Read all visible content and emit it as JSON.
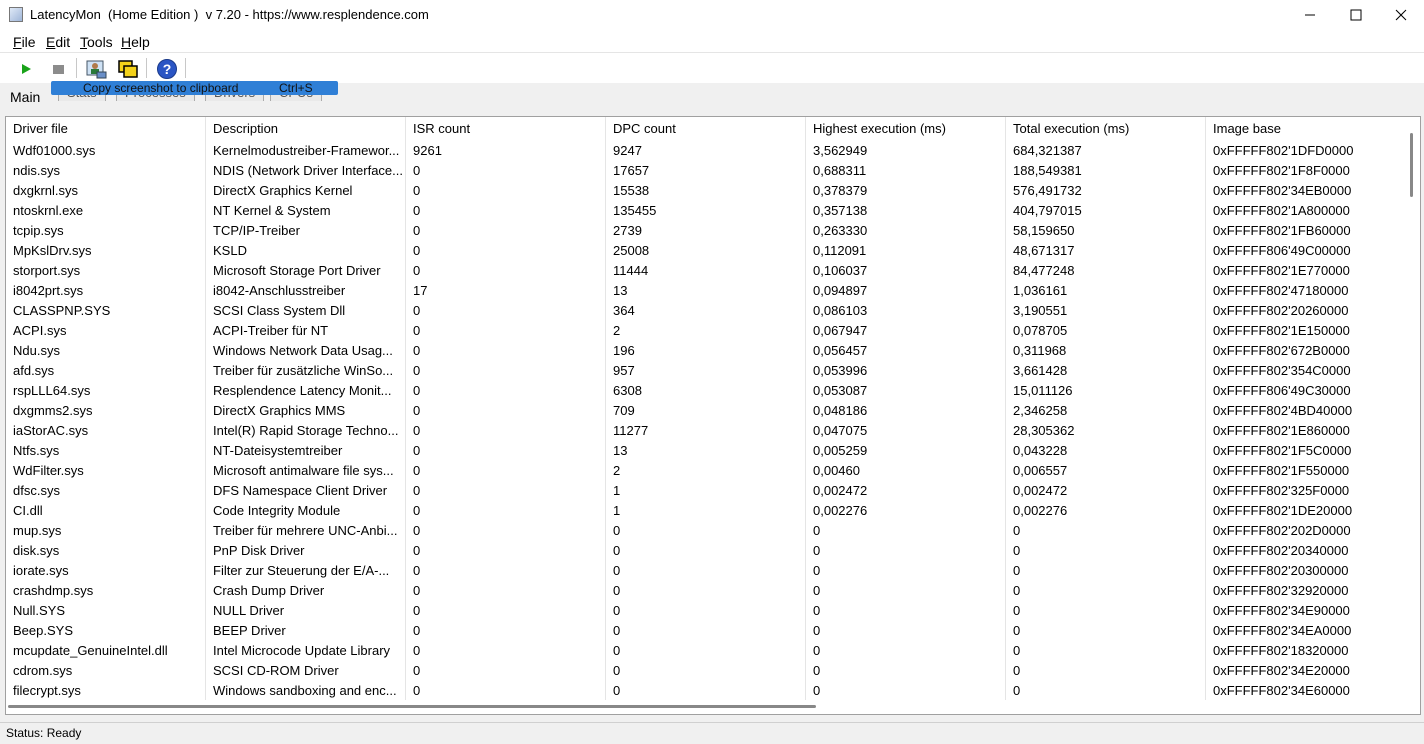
{
  "window": {
    "title": "LatencyMon  (Home Edition )  v 7.20 - https://www.resplendence.com"
  },
  "menu": [
    {
      "ul": "F",
      "rest": "ile"
    },
    {
      "ul": "E",
      "rest": "dit"
    },
    {
      "ul": "T",
      "rest": "ools"
    },
    {
      "ul": "H",
      "rest": "elp"
    }
  ],
  "toolbar": {
    "icons": [
      "play-icon",
      "stop-icon",
      "screenshot-user-icon",
      "copy-windows-icon",
      "help-icon"
    ]
  },
  "tabs": [
    "Main",
    "Stats",
    "Processes",
    "Drivers",
    "CPUs"
  ],
  "tooltip": {
    "label": "Copy screenshot to clipboard",
    "shortcut": "Ctrl+S"
  },
  "table": {
    "columns": [
      "Driver file",
      "Description",
      "ISR count",
      "DPC count",
      "Highest execution (ms)",
      "Total execution (ms)",
      "Image base"
    ],
    "rows": [
      [
        "Wdf01000.sys",
        "Kernelmodustreiber-Framewor...",
        "9261",
        "9247",
        "3,562949",
        "684,321387",
        "0xFFFFF802'1DFD0000"
      ],
      [
        "ndis.sys",
        "NDIS (Network Driver Interface...",
        "0",
        "17657",
        "0,688311",
        "188,549381",
        "0xFFFFF802'1F8F0000"
      ],
      [
        "dxgkrnl.sys",
        "DirectX Graphics Kernel",
        "0",
        "15538",
        "0,378379",
        "576,491732",
        "0xFFFFF802'34EB0000"
      ],
      [
        "ntoskrnl.exe",
        "NT Kernel & System",
        "0",
        "135455",
        "0,357138",
        "404,797015",
        "0xFFFFF802'1A800000"
      ],
      [
        "tcpip.sys",
        "TCP/IP-Treiber",
        "0",
        "2739",
        "0,263330",
        "58,159650",
        "0xFFFFF802'1FB60000"
      ],
      [
        "MpKslDrv.sys",
        "KSLD",
        "0",
        "25008",
        "0,112091",
        "48,671317",
        "0xFFFFF806'49C00000"
      ],
      [
        "storport.sys",
        "Microsoft Storage Port Driver",
        "0",
        "11444",
        "0,106037",
        "84,477248",
        "0xFFFFF802'1E770000"
      ],
      [
        "i8042prt.sys",
        "i8042-Anschlusstreiber",
        "17",
        "13",
        "0,094897",
        "1,036161",
        "0xFFFFF802'47180000"
      ],
      [
        "CLASSPNP.SYS",
        "SCSI Class System Dll",
        "0",
        "364",
        "0,086103",
        "3,190551",
        "0xFFFFF802'20260000"
      ],
      [
        "ACPI.sys",
        "ACPI-Treiber für NT",
        "0",
        "2",
        "0,067947",
        "0,078705",
        "0xFFFFF802'1E150000"
      ],
      [
        "Ndu.sys",
        "Windows Network Data Usag...",
        "0",
        "196",
        "0,056457",
        "0,311968",
        "0xFFFFF802'672B0000"
      ],
      [
        "afd.sys",
        "Treiber für zusätzliche WinSo...",
        "0",
        "957",
        "0,053996",
        "3,661428",
        "0xFFFFF802'354C0000"
      ],
      [
        "rspLLL64.sys",
        "Resplendence Latency Monit...",
        "0",
        "6308",
        "0,053087",
        "15,011126",
        "0xFFFFF806'49C30000"
      ],
      [
        "dxgmms2.sys",
        "DirectX Graphics MMS",
        "0",
        "709",
        "0,048186",
        "2,346258",
        "0xFFFFF802'4BD40000"
      ],
      [
        "iaStorAC.sys",
        "Intel(R) Rapid Storage Techno...",
        "0",
        "11277",
        "0,047075",
        "28,305362",
        "0xFFFFF802'1E860000"
      ],
      [
        "Ntfs.sys",
        "NT-Dateisystemtreiber",
        "0",
        "13",
        "0,005259",
        "0,043228",
        "0xFFFFF802'1F5C0000"
      ],
      [
        "WdFilter.sys",
        "Microsoft antimalware file sys...",
        "0",
        "2",
        "0,00460",
        "0,006557",
        "0xFFFFF802'1F550000"
      ],
      [
        "dfsc.sys",
        "DFS Namespace Client Driver",
        "0",
        "1",
        "0,002472",
        "0,002472",
        "0xFFFFF802'325F0000"
      ],
      [
        "CI.dll",
        "Code Integrity Module",
        "0",
        "1",
        "0,002276",
        "0,002276",
        "0xFFFFF802'1DE20000"
      ],
      [
        "mup.sys",
        "Treiber für mehrere UNC-Anbi...",
        "0",
        "0",
        "0",
        "0",
        "0xFFFFF802'202D0000"
      ],
      [
        "disk.sys",
        "PnP Disk Driver",
        "0",
        "0",
        "0",
        "0",
        "0xFFFFF802'20340000"
      ],
      [
        "iorate.sys",
        "Filter zur Steuerung der E/A-...",
        "0",
        "0",
        "0",
        "0",
        "0xFFFFF802'20300000"
      ],
      [
        "crashdmp.sys",
        "Crash Dump Driver",
        "0",
        "0",
        "0",
        "0",
        "0xFFFFF802'32920000"
      ],
      [
        "Null.SYS",
        "NULL Driver",
        "0",
        "0",
        "0",
        "0",
        "0xFFFFF802'34E90000"
      ],
      [
        "Beep.SYS",
        "BEEP Driver",
        "0",
        "0",
        "0",
        "0",
        "0xFFFFF802'34EA0000"
      ],
      [
        "mcupdate_GenuineIntel.dll",
        "Intel Microcode Update Library",
        "0",
        "0",
        "0",
        "0",
        "0xFFFFF802'18320000"
      ],
      [
        "cdrom.sys",
        "SCSI CD-ROM Driver",
        "0",
        "0",
        "0",
        "0",
        "0xFFFFF802'34E20000"
      ],
      [
        "filecrypt.sys",
        "Windows sandboxing and enc...",
        "0",
        "0",
        "0",
        "0",
        "0xFFFFF802'34E60000"
      ]
    ]
  },
  "status": {
    "text": "Status: Ready"
  }
}
